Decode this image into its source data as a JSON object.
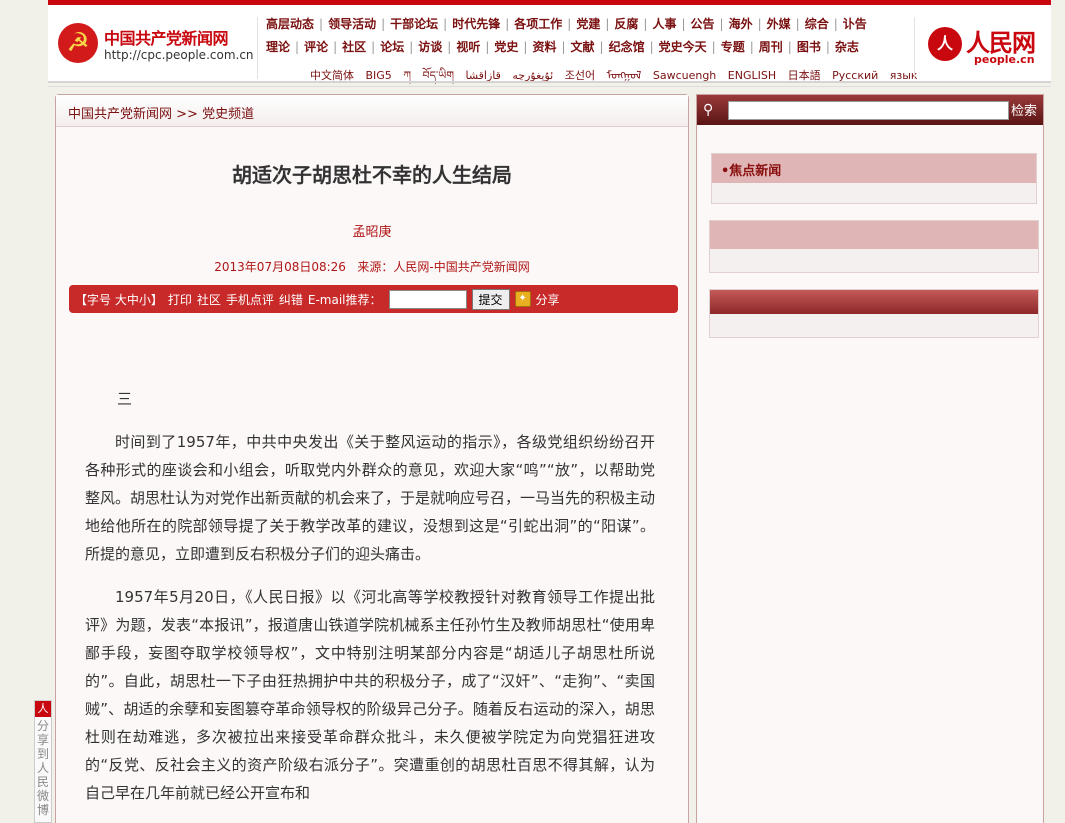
{
  "site": {
    "logo_name": "中国共产党新闻网",
    "logo_url": "http://cpc.people.com.cn",
    "emblem_icon": "party-emblem-icon",
    "partner_logo_name": "人民网",
    "partner_logo_url": "people.cn",
    "brand_color": "#c8070e"
  },
  "nav": {
    "row1": [
      "高层动态",
      "领导活动",
      "干部论坛",
      "时代先锋",
      "各项工作",
      "党建",
      "反腐",
      "人事",
      "公告",
      "海外",
      "外媒",
      "综合",
      "讣告"
    ],
    "row2": [
      "理论",
      "评论",
      "社区",
      "论坛",
      "访谈",
      "视听",
      "党史",
      "资料",
      "文献",
      "纪念馆",
      "党史今天",
      "专题",
      "周刊",
      "图书",
      "杂志"
    ],
    "languages": "中文简体 BIG5 ཀ བོད་ཡིག ئۇيغۇرچە قازاقشا 조선어 ᠮᠣᠩᠭᠣᠯ Sawcuengh ENGLISH 日本語 Русский язык"
  },
  "breadcrumb": {
    "home": "中国共产党新闻网",
    "separator": ">>",
    "channel": "党史频道"
  },
  "article": {
    "title": "胡适次子胡思杜不幸的人生结局",
    "author": "孟昭庚",
    "date": "2013年07月08日08:26",
    "source": "来源：人民网-中国共产党新闻网",
    "section_number": "三",
    "paragraphs": [
      "时间到了1957年，中共中央发出《关于整风运动的指示》，各级党组织纷纷召开各种形式的座谈会和小组会，听取党内外群众的意见，欢迎大家“鸣”“放”，以帮助党整风。胡思杜认为对党作出新贡献的机会来了，于是就响应号召，一马当先的积极主动地给他所在的院部领导提了关于教学改革的建议，没想到这是“引蛇出洞”的“阳谋”。所提的意见，立即遭到反右积极分子们的迎头痛击。",
      "1957年5月20日，《人民日报》以《河北高等学校教授针对教育领导工作提出批评》为题，发表“本报讯”，报道唐山铁道学院机械系主任孙竹生及教师胡思杜“使用卑鄙手段，妄图夺取学校领导权”，文中特别注明某部分内容是“胡适儿子胡思杜所说的”。自此，胡思杜一下子由狂热拥护中共的积极分子，成了“汉奸”、“走狗”、“卖国贼”、胡适的余孽和妄图篡夺革命领导权的阶级异己分子。随着反右运动的深入，胡思杜则在劫难逃，多次被拉出来接受革命群众批斗，未久便被学院定为向党猖狂进攻的“反党、反社会主义的资产阶级右派分子”。突遭重创的胡思杜百思不得其解，认为自己早在几年前就已经公开宣布和"
    ]
  },
  "toolbar": {
    "font_size": "【字号 大中小】",
    "print": "打印",
    "community": "社区",
    "mobile_comment": "手机点评",
    "correction": "纠错",
    "email_label": "E-mail推荐：",
    "submit": "提交",
    "share": "分享",
    "share_icon": "share-icon"
  },
  "sidebar": {
    "search_button": "检索",
    "search_icon": "magnifier-icon",
    "focus_news": "•焦点新闻"
  },
  "share_widget": {
    "icon": "人",
    "label": "分享到人民微博"
  }
}
